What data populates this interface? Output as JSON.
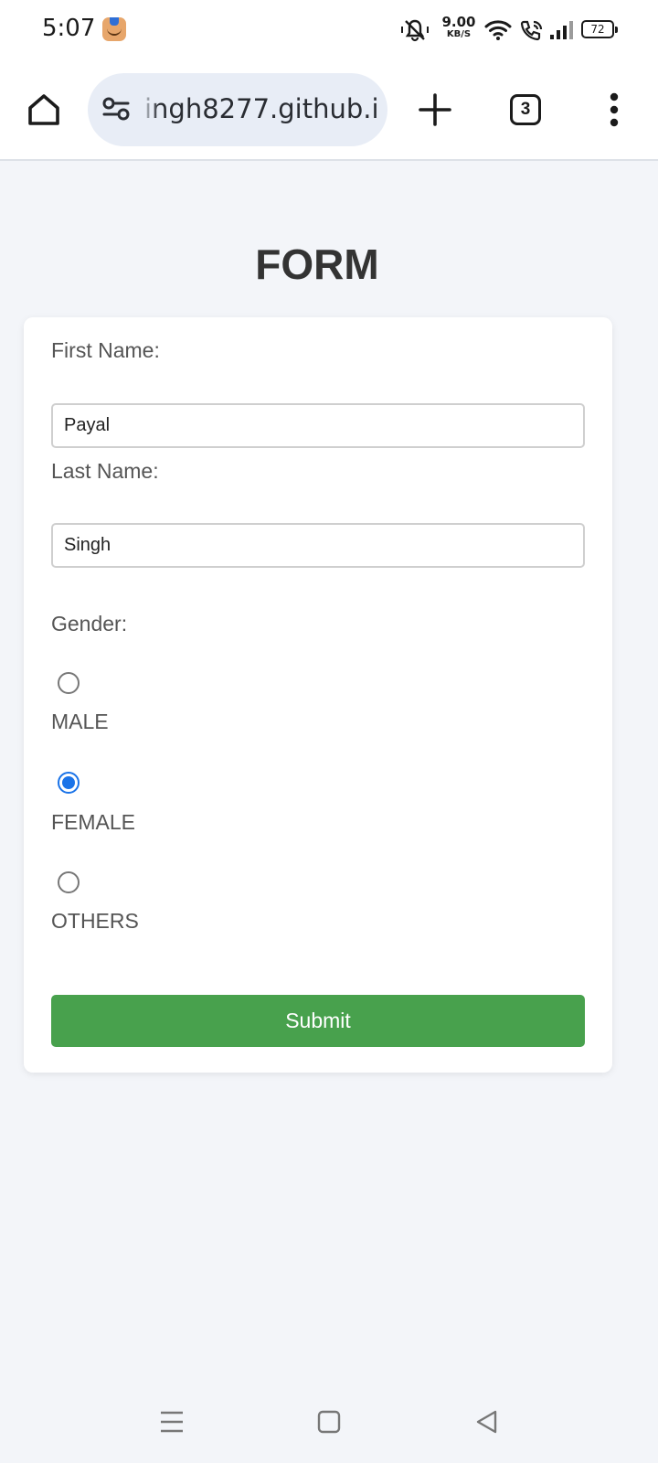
{
  "status_bar": {
    "time": "5:07",
    "notification_icon": "amazon-app-icon",
    "net_speed_value": "9.00",
    "net_speed_unit": "KB/S",
    "battery_level": "72",
    "icons": [
      "silent-mode-icon",
      "wifi-icon",
      "wifi-calling-icon",
      "signal-icon",
      "battery-icon"
    ]
  },
  "browser": {
    "url": "ingh8277.github.i",
    "tab_count": "3",
    "icons": [
      "home-icon",
      "site-settings-icon",
      "new-tab-icon",
      "tab-switcher-icon",
      "more-menu-icon"
    ]
  },
  "page": {
    "title": "FORM",
    "first_name_label": "First Name:",
    "first_name_value": "Payal",
    "last_name_label": "Last Name:",
    "last_name_value": "Singh",
    "gender_label": "Gender:",
    "gender_options": [
      {
        "label": "MALE",
        "checked": false
      },
      {
        "label": "FEMALE",
        "checked": true
      },
      {
        "label": "OTHERS",
        "checked": false
      }
    ],
    "submit_label": "Submit",
    "colors": {
      "accent_radio": "#1a73e8",
      "submit_bg": "#48a14d",
      "page_bg": "#f3f5f9"
    }
  },
  "nav_bar": {
    "icons": [
      "recents-icon",
      "home-nav-icon",
      "back-icon"
    ]
  }
}
